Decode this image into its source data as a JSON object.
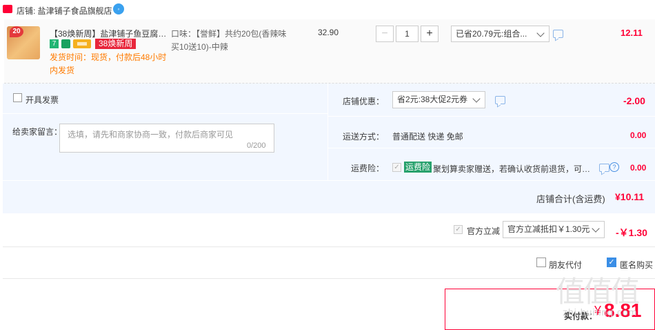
{
  "shop": {
    "badge": "天猫",
    "label": "店铺: 盐津铺子食品旗舰店",
    "ww_icon": "wangwang-icon"
  },
  "item": {
    "thumb_badge": "20",
    "title": "【38焕新周】盐津铺子鱼豆腐豆...",
    "tags": {
      "seven": "7",
      "promo": "38焕新周"
    },
    "ship_line1": "发货时间：现货，付款后48小时",
    "ship_line2": "内发货",
    "sku_line1": "口味：【誉鲜】共约20包(香辣味",
    "sku_line2": "买10送10)-中辣",
    "unit_price": "32.90",
    "qty": "1",
    "qty_minus": "−",
    "qty_plus": "+",
    "promo_selected": "已省20.79元:组合...",
    "total": "12.11"
  },
  "invoice": {
    "label": "开具发票"
  },
  "message": {
    "label": "给卖家留言：",
    "placeholder": "选填，请先和商家协商一致，付款后商家可见",
    "count": "0/200"
  },
  "shop_discount": {
    "label": "店铺优惠：",
    "selected": "省2元:38大促2元券",
    "amount": "-2.00"
  },
  "shipping": {
    "label": "运送方式：",
    "value": "普通配送 快递 免邮",
    "amount": "0.00"
  },
  "freight_insurance": {
    "label": "运费险：",
    "check": "✓",
    "badge": "运费险",
    "text": "聚划算卖家赠送，若确认收货前退货，可获...",
    "help": "?",
    "amount": "0.00"
  },
  "shop_total": {
    "label": "店铺合计(含运费)",
    "value": "¥10.11"
  },
  "official_discount": {
    "check": "✓",
    "label": "官方立减",
    "selected": "官方立减抵扣￥1.30元",
    "amount": "-￥1.30"
  },
  "options": {
    "friend_pay": "朋友代付",
    "anonymous": "匿名购买",
    "anon_check": "✓"
  },
  "payment": {
    "label": "实付款：",
    "currency": "¥",
    "amount": "8.81"
  },
  "watermark": {
    "logo": "值值值",
    "url": "zhi.huiting.com"
  },
  "colors": {
    "accent_red": "#ff0036",
    "orange": "#ff7b00",
    "info_bg": "#f2f7ff",
    "badge_green": "#27a16c",
    "checkbox_blue": "#3a8ee6"
  }
}
